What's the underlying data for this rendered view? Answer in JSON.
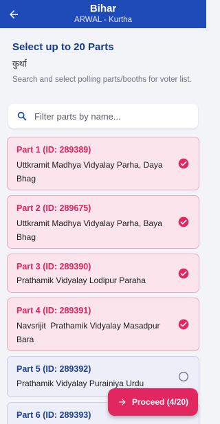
{
  "header": {
    "title": "Bihar",
    "subtitle": "ARWAL - Kurtha"
  },
  "section": {
    "heading": "Select up to 20 Parts",
    "local_name": "कुर्था",
    "helper": "Search and select polling parts/booths for voter list."
  },
  "search": {
    "placeholder": "Filter parts by name...",
    "value": ""
  },
  "parts": [
    {
      "title": "Part 1 (ID: 289389)",
      "name": "Uttkramit Madhya Vidyalay Parha, Daya Bhag",
      "selected": true
    },
    {
      "title": "Part 2 (ID: 289675)",
      "name": "Uttkramit Madhya Vidyalay Parha, Baya Bhag",
      "selected": true
    },
    {
      "title": "Part 3 (ID: 289390)",
      "name": "Prathamik Vidyalay Lodipur Paraha",
      "selected": true
    },
    {
      "title": "Part 4 (ID: 289391)",
      "name": "Navsrijit  Prathamik Vidyalay Masadpur Bara",
      "selected": true
    },
    {
      "title": "Part 5 (ID: 289392)",
      "name": "Prathamik Vidyalay Purainiya Urdu",
      "selected": false
    },
    {
      "title": "Part 6 (ID: 289393)",
      "name": "",
      "selected": false
    }
  ],
  "proceed": {
    "label": "Proceed (4/20)"
  },
  "colors": {
    "appbar": "#1f4bb8",
    "accent": "#e2265f",
    "selected_card": "#fbe4ec",
    "unselected_card": "#eceef8"
  },
  "icons": {
    "back": "arrow-left-icon",
    "search": "search-icon",
    "checked": "check-circle-icon",
    "unchecked": "empty-circle-icon",
    "proceed": "arrow-right-icon"
  }
}
